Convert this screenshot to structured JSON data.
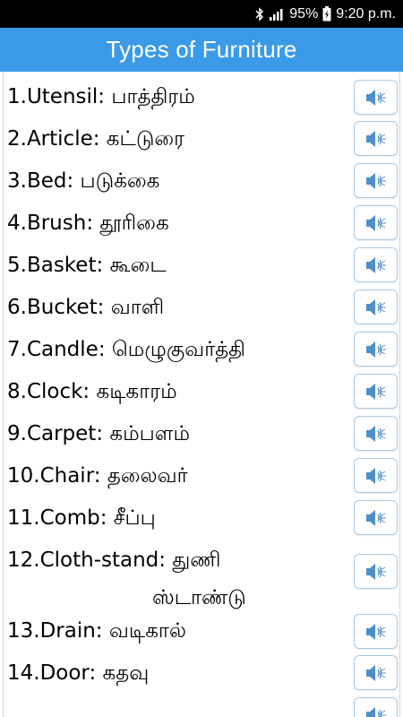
{
  "status_bar": {
    "battery": "95%",
    "time": "9:20 p.m.",
    "icons": [
      "bluetooth-icon",
      "signal-icon",
      "battery-icon"
    ]
  },
  "app_bar": {
    "title": "Types of Furniture"
  },
  "accent_color": "#3a9ae8",
  "words": [
    {
      "label": "1.Utensil:",
      "tamil": "பாத்திரம்"
    },
    {
      "label": "2.Article:",
      "tamil": "கட்டுரை"
    },
    {
      "label": "3.Bed:",
      "tamil": "படுக்கை"
    },
    {
      "label": "4.Brush:",
      "tamil": "தூரிகை"
    },
    {
      "label": "5.Basket:",
      "tamil": "கூடை"
    },
    {
      "label": "6.Bucket:",
      "tamil": "வாளி"
    },
    {
      "label": "7.Candle:",
      "tamil": "மெழுகுவர்த்தி"
    },
    {
      "label": "8.Clock:",
      "tamil": "கடிகாரம்"
    },
    {
      "label": "9.Carpet:",
      "tamil": "கம்பளம்"
    },
    {
      "label": "10.Chair:",
      "tamil": "தலைவர்"
    },
    {
      "label": "11.Comb:",
      "tamil": "சீப்பு"
    },
    {
      "label": "12.Cloth-stand:",
      "tamil": "துணி ஸ்டாண்டு"
    },
    {
      "label": "13.Drain:",
      "tamil": "வடிகால்"
    },
    {
      "label": "14.Door:",
      "tamil": "கதவு"
    }
  ],
  "speaker_icon": "speaker-icon"
}
